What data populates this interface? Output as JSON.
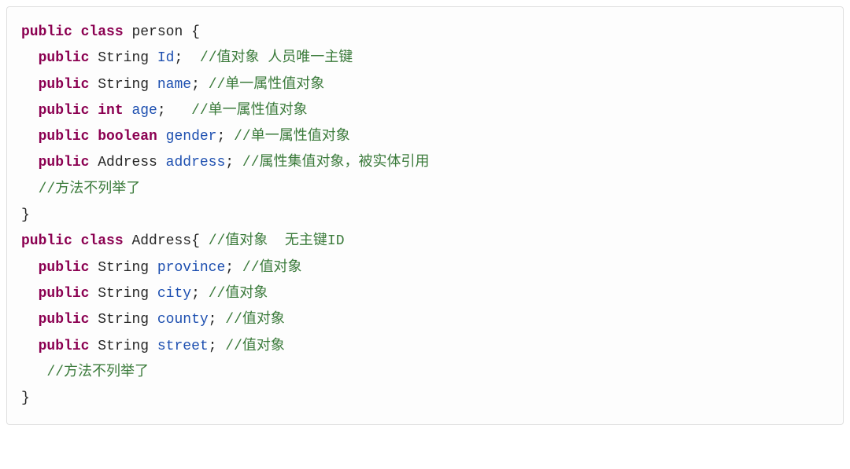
{
  "code": {
    "class1": "person",
    "class2": "Address",
    "kw_public": "public",
    "kw_class": "class",
    "kw_int": "int",
    "kw_boolean": "boolean",
    "type_string": "String",
    "type_address": "Address",
    "f_id": "Id",
    "f_name": "name",
    "f_age": "age",
    "f_gender": "gender",
    "f_address": "address",
    "f_province": "province",
    "f_city": "city",
    "f_county": "county",
    "f_street": "street",
    "c_id": "//值对象 人员唯一主键",
    "c_name": "//单一属性值对象",
    "c_age": "//单一属性值对象",
    "c_gender": "//单一属性值对象",
    "c_address": "//属性集值对象，被实体引用",
    "c_methods1": "//方法不列举了",
    "c_class2": "//值对象  无主键ID",
    "c_province": "//值对象",
    "c_city": "//值对象",
    "c_county": "//值对象",
    "c_street": "//值对象",
    "c_methods2": "//方法不列举了",
    "lbrace": "{",
    "rbrace": "}",
    "semi": ";",
    "space": " "
  }
}
